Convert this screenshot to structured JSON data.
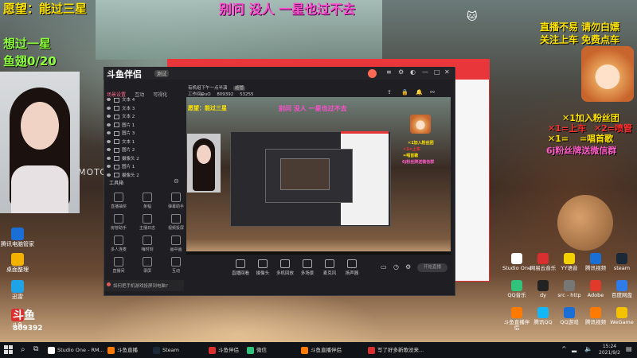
{
  "overlay": {
    "goal": "愿望：能过三星",
    "top_caption": "别问 没人 一星也过不去",
    "left_line1": "想过一星",
    "left_line2": "鱼翅0/20",
    "right_line1": "直播不易 请勿白嫖",
    "right_line2": "关注上车 免费点车",
    "gift1": "✕1加入粉丝团",
    "gift2": "✕1=上车",
    "gift3": "✕2=喷管",
    "gift4": "✕1=",
    "gift5": "=唱首歌",
    "gift6": "6j粉丝牌送微信群",
    "room_label": "斗鱼",
    "room_number": "809392"
  },
  "webcam": {
    "watermark": "MOTC"
  },
  "desktop_left": [
    {
      "label": "腾讯电脑管家",
      "color": "#1a6fd6"
    },
    {
      "label": "桌面整理",
      "color": "#f3b100"
    },
    {
      "label": "迅雷",
      "color": "#1ea3e6"
    },
    {
      "label": "斗鱼",
      "color": "#d92f2f"
    }
  ],
  "desktop_right": [
    {
      "label": "Studio One",
      "color": "#ffffff"
    },
    {
      "label": "网易云音乐",
      "color": "#d92f2f"
    },
    {
      "label": "YY语音",
      "color": "#f3d100"
    },
    {
      "label": "腾讯视频",
      "color": "#1a6fd6"
    },
    {
      "label": "steam",
      "color": "#1b2838"
    },
    {
      "label": "QQ音乐",
      "color": "#31c27c"
    },
    {
      "label": "dy",
      "color": "#222222"
    },
    {
      "label": "src - http",
      "color": "#777777"
    },
    {
      "label": "Adobe",
      "color": "#e03a2a"
    },
    {
      "label": "百度网盘",
      "color": "#2f7be8"
    },
    {
      "label": "斗鱼直播伴侣",
      "color": "#ff7a00"
    },
    {
      "label": "腾讯QQ",
      "color": "#12b7f5"
    },
    {
      "label": "QQ游戏",
      "color": "#1a6fd6"
    },
    {
      "label": "腾讯视频",
      "color": "#ff7a00"
    },
    {
      "label": "WeGame",
      "color": "#f2c200"
    }
  ],
  "app": {
    "logo": "斗鱼伴侣",
    "version": "测试",
    "tabs": [
      "场景设置",
      "互动",
      "可视化"
    ],
    "sources": [
      "文本 4",
      "文本 3",
      "文本 2",
      "图片 1",
      "图片 3",
      "文本 1",
      "图片 2",
      "摄像头 2",
      "图片 1",
      "摄像头 2"
    ],
    "tools_title": "工具箱",
    "tools": [
      "直播抽奖",
      "条幅",
      "弹幕助手",
      "房管助手",
      "主播日志",
      "视频投屏",
      "多人连麦",
      "嗨时刻",
      "画中画",
      "直播间",
      "录屏",
      "互动"
    ],
    "prompt": "如何把手机游戏投屏到电脑?",
    "preview_header": "有机组下午一点半演",
    "preview_badge": "超管",
    "room_info": "工作间DuO",
    "room_no": "809392",
    "fans": "53255",
    "controls": [
      "直播回看",
      "摄像头",
      "多机回放",
      "多场景",
      "麦克风",
      "扬声器"
    ],
    "start_button": "开始直播"
  },
  "taskbar": {
    "items": [
      {
        "label": "Studio One - RM...",
        "color": "#ffffff"
      },
      {
        "label": "斗鱼直播",
        "color": "#ff7a00"
      },
      {
        "label": "Steam",
        "color": "#1b2838"
      },
      {
        "label": "斗鱼伴侣",
        "color": "#d92f2f"
      },
      {
        "label": "微信",
        "color": "#31c27c"
      },
      {
        "label": "斗鱼直播伴侣",
        "color": "#ff7a00"
      },
      {
        "label": "写了好多新歌没来...",
        "color": "#d92f2f"
      }
    ],
    "time": "15:24",
    "date": "2021/9/2"
  }
}
